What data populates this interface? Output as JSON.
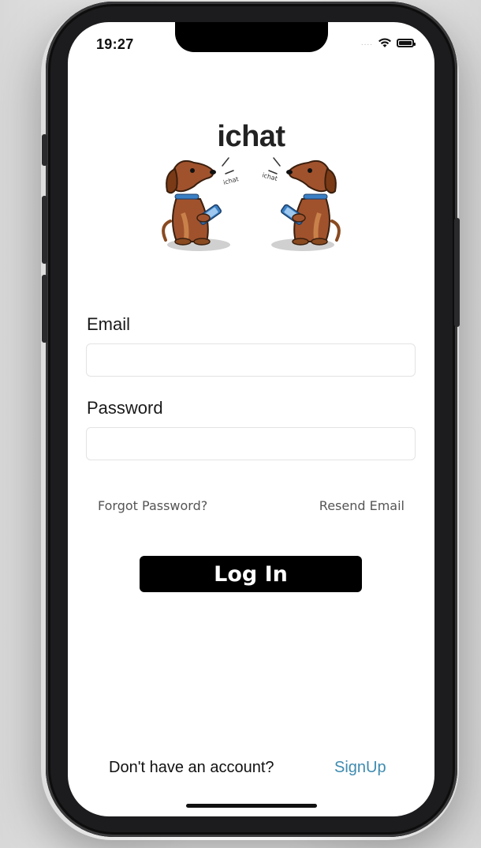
{
  "status_bar": {
    "time": "19:27",
    "signal": "....",
    "wifi_icon": "wifi-icon",
    "battery_icon": "battery-icon"
  },
  "logo": {
    "text": "ichat",
    "speech_left": "ichat",
    "speech_right": "ichat"
  },
  "form": {
    "email_label": "Email",
    "email_value": "",
    "password_label": "Password",
    "password_value": ""
  },
  "links": {
    "forgot_password": "Forgot Password?",
    "resend_email": "Resend Email"
  },
  "login_button": {
    "label": "Log In"
  },
  "footer": {
    "prompt": "Don't have an account?",
    "signup": "SignUp"
  },
  "colors": {
    "accent_link": "#3e8bb0",
    "button_bg": "#000000",
    "dog_brown": "#a0522d",
    "collar_blue": "#3a7fc4"
  }
}
